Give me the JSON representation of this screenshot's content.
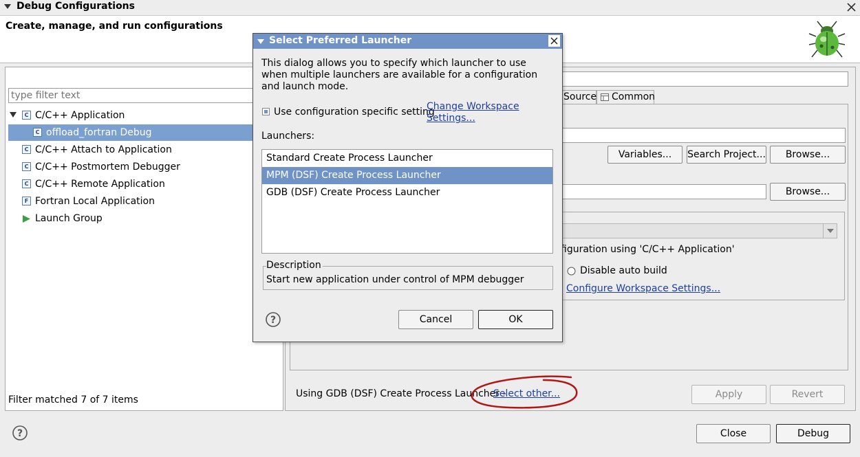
{
  "window": {
    "title": "Debug Configurations",
    "header_title": "Create, manage, and run configurations"
  },
  "toolbar": {
    "icons": [
      "new-config-icon",
      "duplicate-icon",
      "delete-icon",
      "collapse-all-icon",
      "filter-icon",
      "dropdown-arrow-icon"
    ]
  },
  "left_pane": {
    "filter_placeholder": "type filter text",
    "tree": [
      {
        "label": "C/C++ Application",
        "icon": "C",
        "expanded": true
      },
      {
        "label": "offload_fortran Debug",
        "icon": "C",
        "child": true,
        "selected": true
      },
      {
        "label": "C/C++ Attach to Application",
        "icon": "C"
      },
      {
        "label": "C/C++ Postmortem Debugger",
        "icon": "C"
      },
      {
        "label": "C/C++ Remote Application",
        "icon": "C"
      },
      {
        "label": "Fortran Local Application",
        "icon": "F"
      },
      {
        "label": "Launch Group",
        "icon": "launch-group"
      }
    ],
    "status": "Filter matched 7 of 7 items"
  },
  "right_pane": {
    "tabs": [
      "Source",
      "Common"
    ],
    "buttons": {
      "variables": "Variables...",
      "search_project": "Search Project...",
      "browse1": "Browse...",
      "browse2": "Browse..."
    },
    "build_text": "figuration using 'C/C++ Application'",
    "disable_auto_build": "Disable auto build",
    "configure_workspace": "Configure Workspace Settings...",
    "launcher_text": "Using GDB (DSF) Create Process Launcher - ",
    "select_other": "Select other...",
    "apply": "Apply",
    "revert": "Revert"
  },
  "footer": {
    "close": "Close",
    "debug": "Debug"
  },
  "dialog": {
    "title": "Select Preferred Launcher",
    "intro": "This dialog allows you to specify which launcher to use when multiple launchers are available for a configuration and launch mode.",
    "use_specific": "Use configuration specific setting",
    "change_workspace": "Change Workspace Settings...",
    "launchers_label": "Launchers:",
    "launchers": [
      "Standard Create Process Launcher",
      "MPM (DSF) Create Process Launcher",
      "GDB (DSF) Create Process Launcher"
    ],
    "selected_index": 1,
    "description_label": "Description",
    "description": "Start new application under control of MPM debugger",
    "cancel": "Cancel",
    "ok": "OK"
  },
  "colors": {
    "selection": "#7b9fcf",
    "dialog_title": "#6f93c7",
    "annotation": "#b01818",
    "link": "#1f3fa0"
  }
}
